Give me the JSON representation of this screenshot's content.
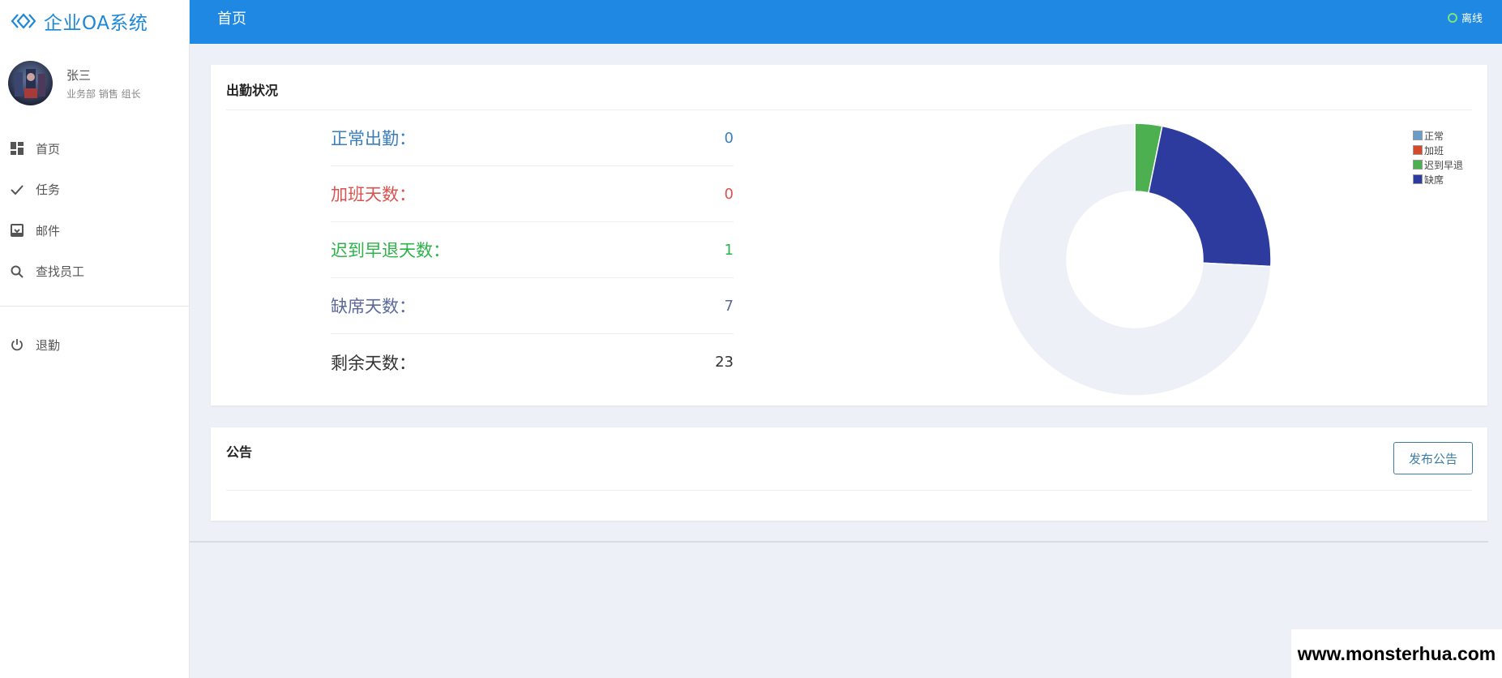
{
  "app": {
    "brand": "企业OA系统"
  },
  "user": {
    "name": "张三",
    "role": "业务部 销售 组长"
  },
  "nav": {
    "items": [
      {
        "label": "首页",
        "icon": "dashboard-icon"
      },
      {
        "label": "任务",
        "icon": "check-icon"
      },
      {
        "label": "邮件",
        "icon": "inbox-icon"
      },
      {
        "label": "查找员工",
        "icon": "search-icon"
      }
    ],
    "logout": {
      "label": "退勤",
      "icon": "power-icon"
    }
  },
  "header": {
    "title": "首页",
    "status": "离线",
    "status_color": "#7ee37e"
  },
  "attendance": {
    "title": "出勤状况",
    "stats": [
      {
        "label": "正常出勤：",
        "value": "0",
        "color": "#3a7ebd"
      },
      {
        "label": "加班天数：",
        "value": "0",
        "color": "#d9534f"
      },
      {
        "label": "迟到早退天数：",
        "value": "1",
        "color": "#2eb34a"
      },
      {
        "label": "缺席天数：",
        "value": "7",
        "color": "#5b6a9a"
      },
      {
        "label": "剩余天数：",
        "value": "23",
        "color": "#333333"
      }
    ]
  },
  "chart_data": {
    "type": "pie",
    "donut": true,
    "categories": [
      "正常",
      "加班",
      "迟到早退",
      "缺席",
      "剩余"
    ],
    "values": [
      0,
      0,
      1,
      7,
      23
    ],
    "colors": [
      "#6a9ec8",
      "#d44a2a",
      "#4caf50",
      "#2e3b9e",
      "#edf0f6"
    ],
    "legend": [
      "正常",
      "加班",
      "迟到早退",
      "缺席"
    ],
    "legend_position": "top-right"
  },
  "notice": {
    "title": "公告",
    "publish_label": "发布公告"
  },
  "watermark": "www.monsterhua.com"
}
